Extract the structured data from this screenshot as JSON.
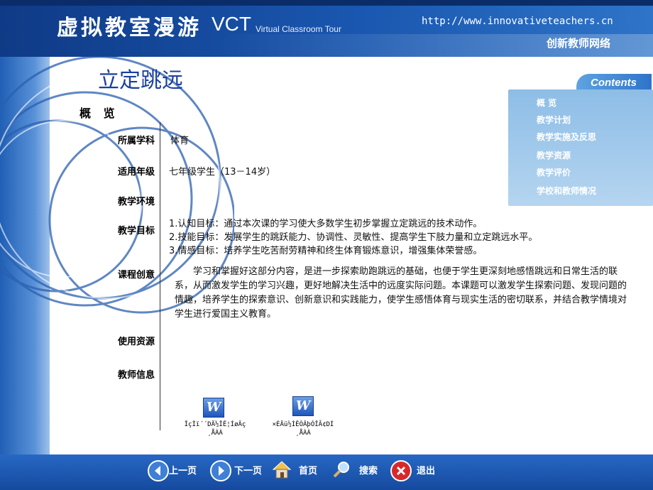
{
  "header": {
    "logo_text": "虚拟教室漫游",
    "vct": "VCT",
    "vct_subtitle": "Virtual Classroom Tour",
    "url": "http://www.innovativeteachers.cn",
    "org": "创新教师网络"
  },
  "contents": {
    "tab_label": "Contents",
    "items": [
      "概  览",
      "教学计划",
      "教学实施及反思",
      "教学资源",
      "教学评价",
      "学校和教师情况"
    ]
  },
  "page": {
    "title": "立定跳远",
    "section": "概 览"
  },
  "fields": {
    "subject_label": "所属学科",
    "subject_value": "体育",
    "grade_label": "适用年级",
    "grade_value": "七年级学生（13－14岁）",
    "env_label": "教学环境",
    "goals_label": "教学目标",
    "goals": [
      "1.认知目标：通过本次课的学习使大多数学生初步掌握立定跳远的技术动作。",
      "2.技能目标：发展学生的跳跃能力、协调性、灵敏性、提高学生下肢力量和立定跳远水平。",
      "3.情感目标：培养学生吃苦耐劳精神和终生体育锻炼意识，增强集体荣誉感。"
    ],
    "idea_label": "课程创意",
    "idea_text": "学习和掌握好这部分内容，是进一步探索助跑跳远的基础，也便于学生更深刻地感悟跳远和日常生活的联系，从而激发学生的学习兴趣，更好地解决生活中的远度实际问题。本课题可以激发学生探索问题、发现问题的情趣，培养学生的探索意识、创新意识和实践能力，使学生感悟体育与现实生活的密切联系，并结合教学情境对学生进行爱国主义教育。",
    "resources_label": "使用资源",
    "teacher_label": "教师信息"
  },
  "documents": [
    {
      "icon": "W",
      "name_line1": "Îçİï´´DÄ½ÎÊ¦ÍøÂç",
      "name_line2": "¸ÅÀÀ"
    },
    {
      "icon": "W",
      "name_line1": "×ÉÄü½ÌÊÒÂþÓÎÃ¢DÍ",
      "name_line2": "¸ÅÀÀ"
    }
  ],
  "nav": {
    "prev": "上一页",
    "next": "下一页",
    "home": "首页",
    "search": "搜索",
    "exit": "退出"
  }
}
